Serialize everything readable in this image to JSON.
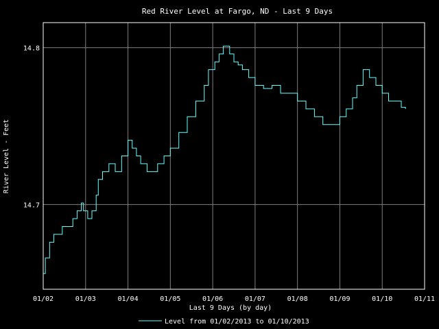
{
  "chart_data": {
    "type": "line",
    "title": "Red River Level at Fargo, ND - Last 9 Days",
    "xlabel": "Last 9 Days (by day)",
    "ylabel": "River Level - Feet",
    "x_ticks": [
      "01/02",
      "01/03",
      "01/04",
      "01/05",
      "01/06",
      "01/07",
      "01/08",
      "01/09",
      "01/10",
      "01/11"
    ],
    "y_ticks": [
      14.7,
      14.8
    ],
    "y_tick_labels": [
      "14.7",
      "14.8"
    ],
    "xlim": [
      0,
      9
    ],
    "ylim": [
      14.646,
      14.816
    ],
    "grid": true,
    "legend": "bottom-center",
    "line_color": "#66ffff",
    "series": [
      {
        "name": "Level from 01/02/2013 to 01/10/2013",
        "x": [
          0.0,
          0.05,
          0.15,
          0.25,
          0.45,
          0.7,
          0.8,
          0.9,
          0.95,
          1.05,
          1.15,
          1.25,
          1.3,
          1.4,
          1.55,
          1.7,
          1.85,
          2.0,
          2.1,
          2.2,
          2.3,
          2.45,
          2.55,
          2.7,
          2.85,
          3.0,
          3.2,
          3.4,
          3.6,
          3.8,
          3.9,
          4.05,
          4.15,
          4.25,
          4.4,
          4.5,
          4.6,
          4.7,
          4.85,
          5.0,
          5.2,
          5.4,
          5.6,
          5.8,
          6.0,
          6.2,
          6.4,
          6.6,
          6.8,
          7.0,
          7.15,
          7.3,
          7.4,
          7.55,
          7.7,
          7.85,
          8.0,
          8.15,
          8.3,
          8.45,
          8.55
        ],
        "y": [
          14.656,
          14.666,
          14.676,
          14.681,
          14.686,
          14.691,
          14.696,
          14.701,
          14.696,
          14.691,
          14.696,
          14.706,
          14.716,
          14.721,
          14.726,
          14.721,
          14.731,
          14.741,
          14.736,
          14.731,
          14.726,
          14.721,
          14.721,
          14.726,
          14.731,
          14.736,
          14.746,
          14.756,
          14.766,
          14.776,
          14.786,
          14.791,
          14.796,
          14.801,
          14.796,
          14.791,
          14.789,
          14.786,
          14.781,
          14.776,
          14.774,
          14.776,
          14.771,
          14.771,
          14.766,
          14.761,
          14.756,
          14.751,
          14.751,
          14.756,
          14.761,
          14.768,
          14.776,
          14.786,
          14.781,
          14.776,
          14.771,
          14.766,
          14.766,
          14.762,
          14.761
        ]
      }
    ]
  }
}
